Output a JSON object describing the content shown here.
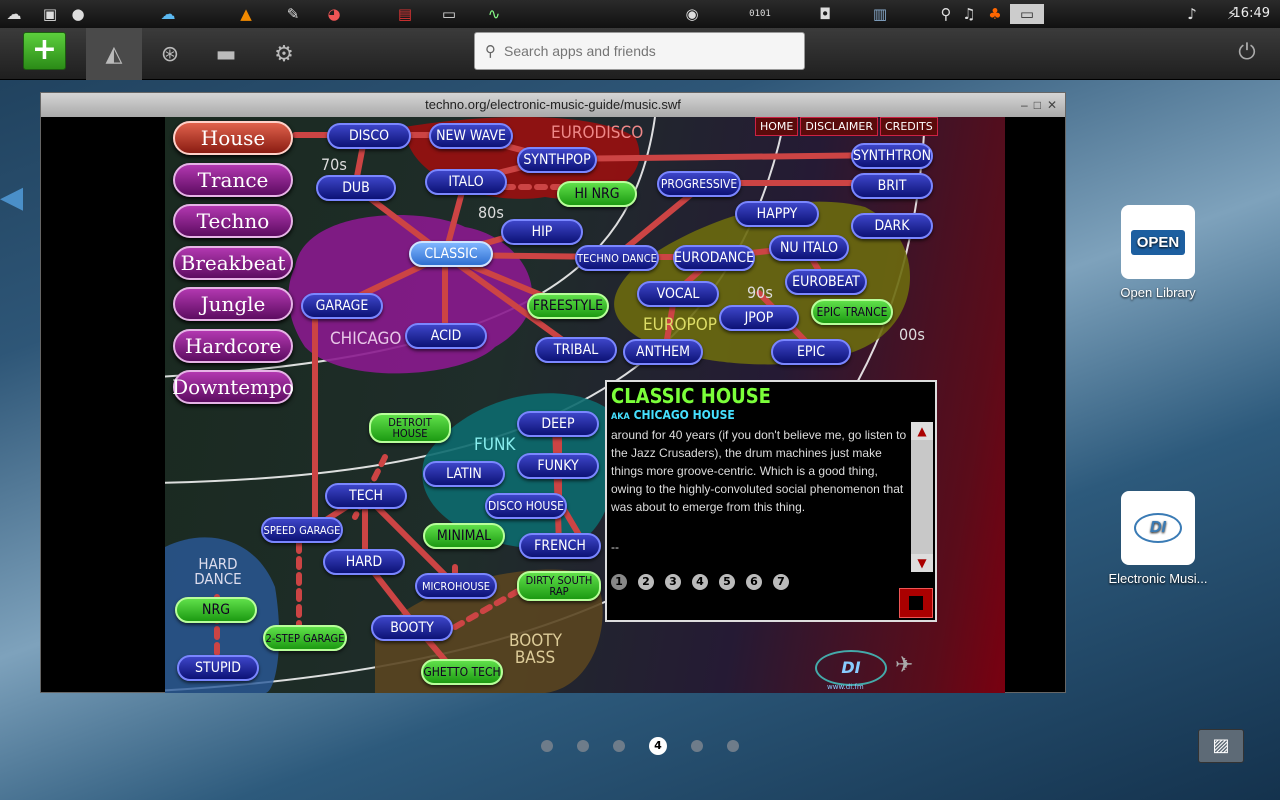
{
  "taskbar": {
    "time": "16:49",
    "icons": [
      "cloud",
      "document",
      "disc",
      "cloud",
      "vlc-cone",
      "notepad",
      "chart",
      "red-app",
      "terminal",
      "monitor",
      "account",
      "binary",
      "camera",
      "vfe",
      "search",
      "music",
      "mushroom",
      "window"
    ]
  },
  "dock": {
    "add_label": "+",
    "search_placeholder": "Search apps and friends"
  },
  "window": {
    "title": "techno.org/electronic-music-guide/music.swf"
  },
  "flash": {
    "nav": [
      "HOME",
      "DISCLAIMER",
      "CREDITS"
    ],
    "categories": [
      "House",
      "Trance",
      "Techno",
      "Breakbeat",
      "Jungle",
      "Hardcore",
      "Downtempo"
    ],
    "eras": {
      "e70": "70s",
      "e80": "80s",
      "e90": "90s",
      "e00": "00s"
    },
    "zones": {
      "eurodisco": "EURODISCO",
      "chicago": "CHICAGO",
      "funk": "FUNK",
      "europop": "EUROPOP",
      "hard_dance": "HARD DANCE",
      "booty_bass": "BOOTY BASS"
    },
    "genres": {
      "disco": "DISCO",
      "new_wave": "NEW WAVE",
      "synthpop": "SYNTHPOP",
      "dub": "DUB",
      "italo": "ITALO",
      "hi_nrg": "HI NRG",
      "hip": "HIP",
      "classic": "CLASSIC",
      "garage": "GARAGE",
      "acid": "ACID",
      "freestyle": "FREESTYLE",
      "tribal": "TRIBAL",
      "progressive": "PROGRESSIVE",
      "happy": "HAPPY",
      "techno_dance": "TECHNO DANCE",
      "eurodance": "EURODANCE",
      "nu_italo": "NU ITALO",
      "eurobeat": "EUROBEAT",
      "vocal": "VOCAL",
      "jpop": "JPOP",
      "epic_trance": "EPIC TRANCE",
      "anthem": "ANTHEM",
      "epic": "EPIC",
      "synthtron": "SYNTHTRON",
      "brit": "BRIT",
      "dark": "DARK",
      "detroit_house": "DETROIT HOUSE",
      "deep": "DEEP",
      "latin": "LATIN",
      "funky": "FUNKY",
      "disco_house": "DISCO HOUSE",
      "tech": "TECH",
      "minimal": "MINIMAL",
      "french": "FRENCH",
      "speed_garage": "SPEED GARAGE",
      "hard": "HARD",
      "microhouse": "MICROHOUSE",
      "dirty_south_rap": "DIRTY SOUTH RAP",
      "nrg": "NRG",
      "two_step": "2-STEP GARAGE",
      "booty": "BOOTY",
      "stupid": "STUPID",
      "ghetto_tech": "GHETTO TECH"
    },
    "info": {
      "title": "CLASSIC HOUSE",
      "aka_label": "AKA",
      "aka": "CHICAGO HOUSE",
      "text": "around for 40 years (if you don't believe me, go listen to the Jazz Crusaders), the drum machines just make things more groove-centric. Which is a good thing, owing to the highly-convoluted social phenomenon that was about to emerge from this thing.",
      "trailer": "--",
      "pages": [
        "1",
        "2",
        "3",
        "4",
        "5",
        "6",
        "7"
      ],
      "current_page": "1"
    },
    "logo": {
      "text": "DI",
      "url": "www.di.fm"
    }
  },
  "desktop": {
    "icons": [
      {
        "label": "Open Library",
        "img_text": "OPEN"
      },
      {
        "label": "Electronic Musi...",
        "img_text": "DI"
      }
    ]
  },
  "workspaces": {
    "count": 6,
    "active": "4"
  }
}
